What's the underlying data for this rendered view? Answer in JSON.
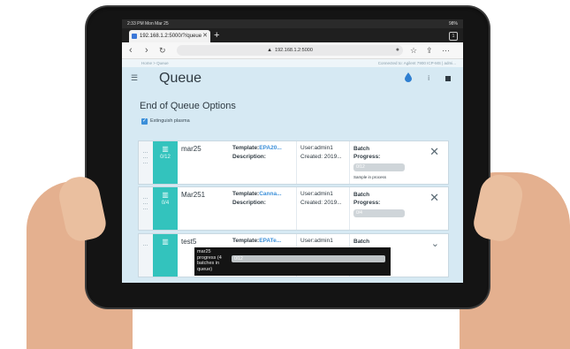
{
  "status_bar": {
    "time": "2:33 PM  Mon Mar 25",
    "battery": "98%"
  },
  "browser": {
    "tab_title": "192.168.1.2:5000/?/queue",
    "tab_count": "1",
    "url": "192.168.1.2:5000",
    "new_tab": "+"
  },
  "app": {
    "breadcrumb": "Home > Queue",
    "connection": "Connected to: Agilent 7900 ICP-MS | admi...",
    "title": "Queue",
    "eoq_title": "End of Queue Options",
    "eoq_checkbox_label": "Extinguish plasma",
    "eoq_checked": true
  },
  "batches": [
    {
      "name": "mar25",
      "count": "0/12",
      "template_label": "Template:",
      "template": "EPA20...",
      "description_label": "Description:",
      "user": "User:admin1",
      "created": "Created: 2019...",
      "progress_label_1": "Batch",
      "progress_label_2": "Progress:",
      "progress_text": "0/12",
      "progress_value": 0,
      "status": "Sample in process"
    },
    {
      "name": "Mar251",
      "count": "0/4",
      "template_label": "Template:",
      "template": "Canna...",
      "description_label": "Description:",
      "user": "User:admin1",
      "created": "Created: 2019...",
      "progress_label_1": "Batch",
      "progress_label_2": "Progress:",
      "progress_text": "0/4",
      "progress_value": 0,
      "status": ""
    },
    {
      "name": "test5",
      "count": "",
      "template_label": "Template:",
      "template": "EPATe...",
      "description_label": "",
      "user": "User:admin1",
      "created": "",
      "progress_label_1": "Batch",
      "progress_label_2": "",
      "progress_text": "",
      "progress_value": 0,
      "status": ""
    }
  ],
  "queue_progress": {
    "label": "mar25 progress (4 batches in queue)",
    "bar_text": "0/12",
    "value": 0
  },
  "colors": {
    "accent": "#33c3bd",
    "link": "#3b8fd9",
    "screen_bg": "#d6e9f3"
  },
  "icons": {
    "menu": "hamburger-icon",
    "plasma": "droplet-icon",
    "info": "info-icon",
    "stop": "stop-icon"
  }
}
